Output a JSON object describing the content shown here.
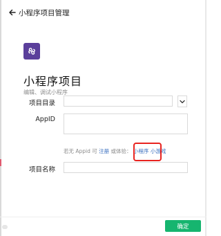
{
  "header": {
    "back_label": "小程序项目管理"
  },
  "project": {
    "title": "小程序项目",
    "subtitle": "编辑、调试小程序"
  },
  "form": {
    "dir_label": "项目目录",
    "dir_value": "",
    "appid_label": "AppID",
    "appid_value": "",
    "name_label": "项目名称",
    "name_value": "",
    "hint_prefix": "若无 Appid 可",
    "hint_register": "注册",
    "hint_or_try": "或体验：",
    "hint_miniprogram": "小程序",
    "hint_minigame": "小游戏"
  },
  "footer": {
    "confirm_label": "确定"
  },
  "icons": {
    "back": "back-arrow-icon",
    "logo": "miniprogram-logo-icon",
    "dropdown": "chevron-down-icon"
  },
  "colors": {
    "accent_green": "#16b56f",
    "logo_purple": "#5b3f9b",
    "link_blue": "#3a6fbf",
    "highlight_red": "#e8231f"
  }
}
